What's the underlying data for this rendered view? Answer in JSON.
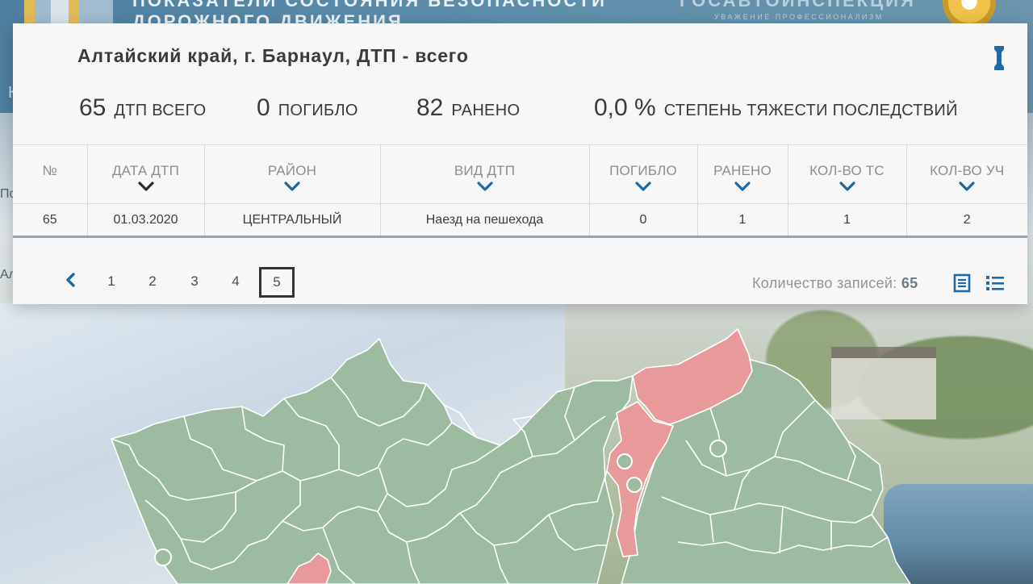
{
  "background": {
    "title_line1": "ПОКАЗАТЕЛИ СОСТОЯНИЯ БЕЗОПАСНОСТИ",
    "title_line2": "ДОРОЖНОГО ДВИЖЕНИЯ",
    "brand": "ГОСАВТОИНСПЕКЦИЯ",
    "brand_sub": "УВАЖЕНИЕ ПРОФЕССИОНАЛИЗМ",
    "left_fragments": [
      "К",
      "По",
      "Ал"
    ]
  },
  "panel": {
    "title": "Алтайский край, г. Барнаул, ДТП - всего",
    "close_icon": "close-icon"
  },
  "stats": [
    {
      "value": "65",
      "label": "ДТП ВСЕГО"
    },
    {
      "value": "0",
      "label": "ПОГИБЛО"
    },
    {
      "value": "82",
      "label": "РАНЕНО"
    },
    {
      "value": "0,0 %",
      "label": "СТЕПЕНЬ ТЯЖЕСТИ ПОСЛЕДСТВИЙ"
    }
  ],
  "table": {
    "columns": [
      "№",
      "ДАТА ДТП",
      "РАЙОН",
      "ВИД ДТП",
      "ПОГИБЛО",
      "РАНЕНО",
      "КОЛ-ВО ТС",
      "КОЛ-ВО УЧ"
    ],
    "rows": [
      [
        "65",
        "01.03.2020",
        "ЦЕНТРАЛЬНЫЙ",
        "Наезд на пешехода",
        "0",
        "1",
        "1",
        "2"
      ]
    ]
  },
  "pager": {
    "pages": [
      "1",
      "2",
      "3",
      "4",
      "5"
    ],
    "active_page": "5",
    "records_label": "Количество записей:",
    "records_count": "65"
  },
  "colors": {
    "accent": "#1f6aa5",
    "map_green": "#9dbba0",
    "map_red": "#e8999a"
  }
}
